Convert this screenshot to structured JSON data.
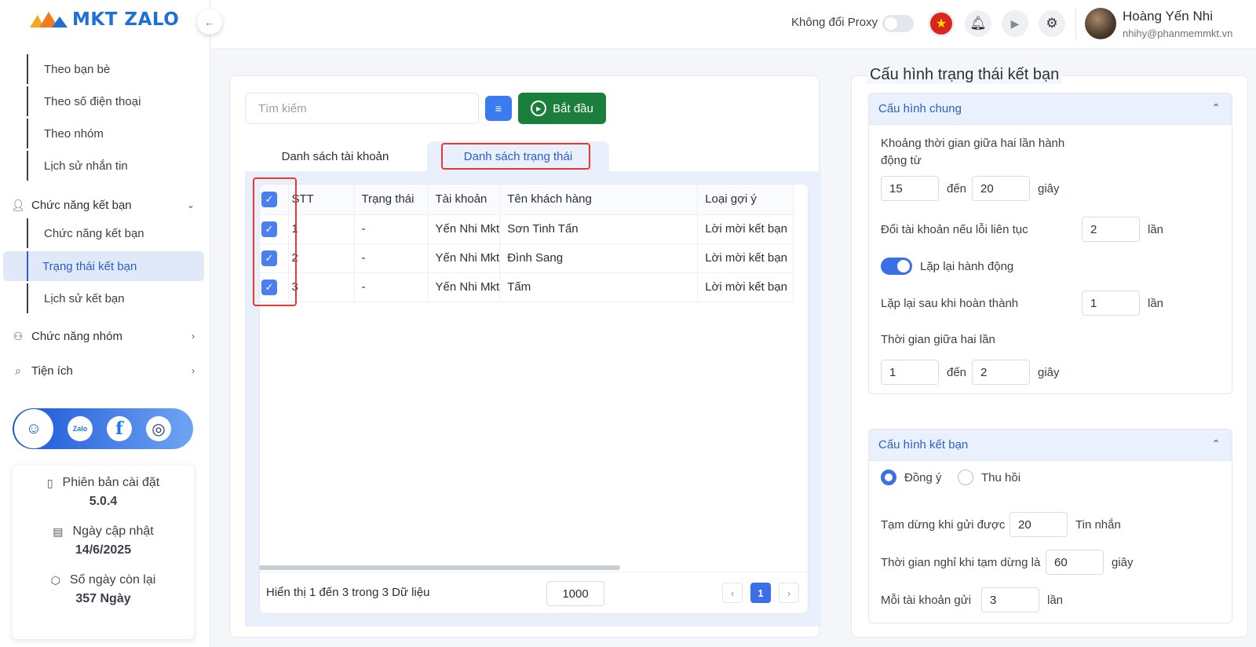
{
  "app": {
    "logo_text": "MKT ZALO"
  },
  "sidebar": {
    "subitems_top": [
      "Theo bạn bè",
      "Theo số điện thoại",
      "Theo nhóm",
      "Lịch sử nhắn tin"
    ],
    "group_friend": "Chức năng kết bạn",
    "friend_items": [
      "Chức năng kết bạn",
      "Trạng thái kết bạn",
      "Lịch sử kết bạn"
    ],
    "group_group": "Chức năng nhóm",
    "group_util": "Tiện ích",
    "social": {
      "zalo": "Zalo",
      "facebook": "f"
    },
    "info": {
      "version_label": "Phiên bản cài đặt",
      "version": "5.0.4",
      "update_label": "Ngày cập nhật",
      "update": "14/6/2025",
      "days_label": "Số ngày còn lại",
      "days": "357 Ngày"
    }
  },
  "header": {
    "proxy_label": "Không đổi Proxy",
    "user_name": "Hoàng Yến Nhi",
    "user_email": "nhihy@phanmemmkt.vn"
  },
  "toolbar": {
    "search_placeholder": "Tìm kiếm",
    "start_label": "Bắt đầu"
  },
  "tabs": [
    "Danh sách tài khoản",
    "Danh sách trạng thái"
  ],
  "table": {
    "columns": [
      "STT",
      "Trạng thái",
      "Tài khoản",
      "Tên khách hàng",
      "Loại gợi ý"
    ],
    "rows": [
      {
        "stt": "1",
        "status": "-",
        "account": "Yến Nhi Mkt",
        "customer": "Sơn Tinh Tấn",
        "type": "Lời mời kết bạn"
      },
      {
        "stt": "2",
        "status": "-",
        "account": "Yến Nhi Mkt",
        "customer": "Đình Sang",
        "type": "Lời mời kết bạn"
      },
      {
        "stt": "3",
        "status": "-",
        "account": "Yến Nhi Mkt",
        "customer": "Tấm",
        "type": "Lời mời kết bạn"
      }
    ],
    "footer_text": "Hiển thị 1 đến 3 trong 3 Dữ liệu",
    "page_size": "1000",
    "current_page": "1"
  },
  "config": {
    "title": "Cấu hình trạng thái kết bạn",
    "general": {
      "title": "Cấu hình chung",
      "interval_label": "Khoảng thời gian giữa hai lần hành động từ",
      "interval_from": "15",
      "to_word": "đến",
      "interval_to": "20",
      "sec_word": "giây",
      "switch_label": "Đổi tài khoản nếu lỗi liên tục",
      "switch_value": "2",
      "times_word": "lần",
      "repeat_label": "Lặp lại hành động",
      "repeat_after_label": "Lặp lại sau khi hoàn thành",
      "repeat_after_value": "1",
      "between_label": "Thời gian giữa hai lần",
      "between_from": "1",
      "between_to": "2"
    },
    "friend": {
      "title": "Cấu hình kết bạn",
      "opt_accept": "Đồng ý",
      "opt_revoke": "Thu hồi",
      "pause_label": "Tạm dừng khi gửi được",
      "pause_value": "20",
      "msg_word": "Tin nhắn",
      "rest_label": "Thời gian nghỉ khi tạm dừng là",
      "rest_value": "60",
      "each_label": "Mỗi tài khoản gửi",
      "each_value": "3"
    }
  }
}
